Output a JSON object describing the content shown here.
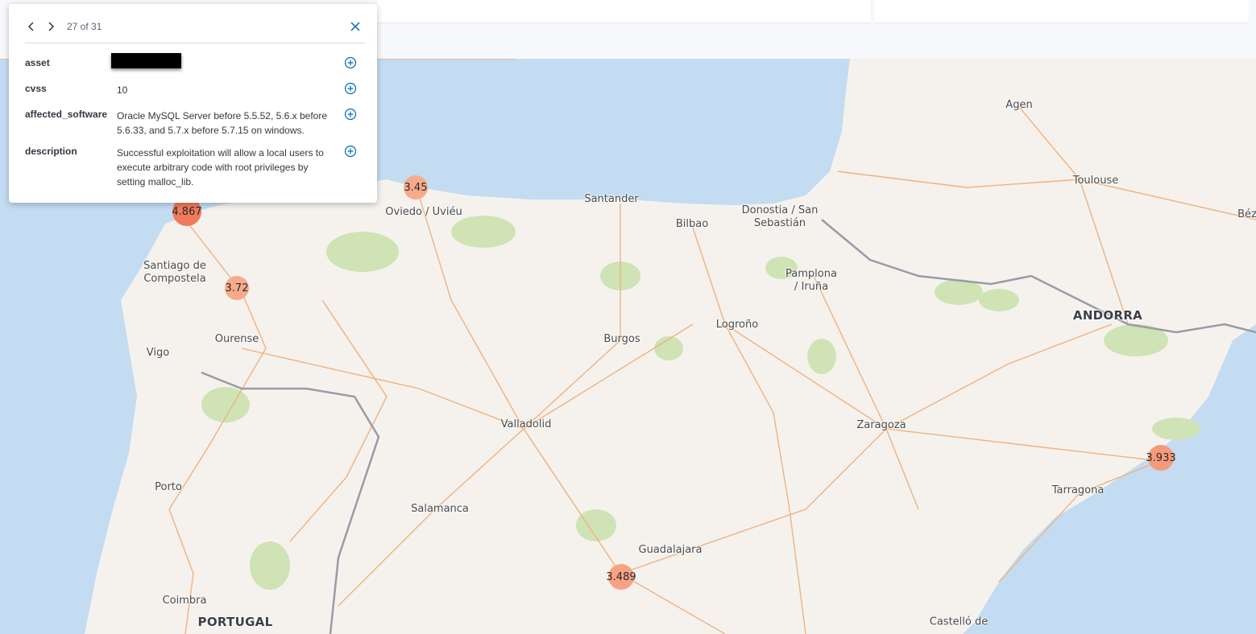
{
  "popup": {
    "counter": "27 of 31",
    "prev_icon": "chevron-left-icon",
    "next_icon": "chevron-right-icon",
    "close_icon": "close-icon",
    "rows": [
      {
        "key": "asset",
        "value": "",
        "redacted": true
      },
      {
        "key": "cvss",
        "value": "10"
      },
      {
        "key": "affected_software",
        "value": "Oracle MySQL Server before 5.5.52, 5.6.x before 5.6.33, and 5.7.x before 5.7.15 on windows."
      },
      {
        "key": "description",
        "value": "Successful exploitation will allow a local users to execute arbitrary code with root privileges by setting malloc_lib."
      }
    ],
    "add_filter_icon": "plus-circle-icon"
  },
  "map": {
    "labels": {
      "agen": "Agen",
      "toulouse": "Toulouse",
      "bez": "Béz",
      "santander": "Santander",
      "oviedo": "Oviedo / Uviéu",
      "bilbao": "Bilbao",
      "donostia": "Donostia / San\nSebastián",
      "pamplona": "Pamplona\n/ Iruña",
      "andorra": "ANDORRA",
      "santiago": "Santiago de\nCompostela",
      "ourense": "Ourense",
      "vigo": "Vigo",
      "burgos": "Burgos",
      "logrono": "Logroño",
      "valladolid": "Valladolid",
      "zaragoza": "Zaragoza",
      "porto": "Porto",
      "salamanca": "Salamanca",
      "tarragona": "Tarragona",
      "guadalajara": "Guadalajara",
      "coimbra": "Coimbra",
      "portugal": "PORTUGAL",
      "castello": "Castelló de\nla Plana"
    },
    "clusters": {
      "c1": "4.867",
      "c2": "3.45",
      "c3": "3.72",
      "c4": "3.933",
      "c5": "3.489"
    },
    "colors": {
      "water": "#c3dcf2",
      "land": "#f5f2ee",
      "road": "#f0b27c",
      "border": "#9a9ba6",
      "park": "#cfe3b5",
      "cluster_strong": "#f07a5a",
      "cluster_light": "#f7ab8c"
    }
  }
}
